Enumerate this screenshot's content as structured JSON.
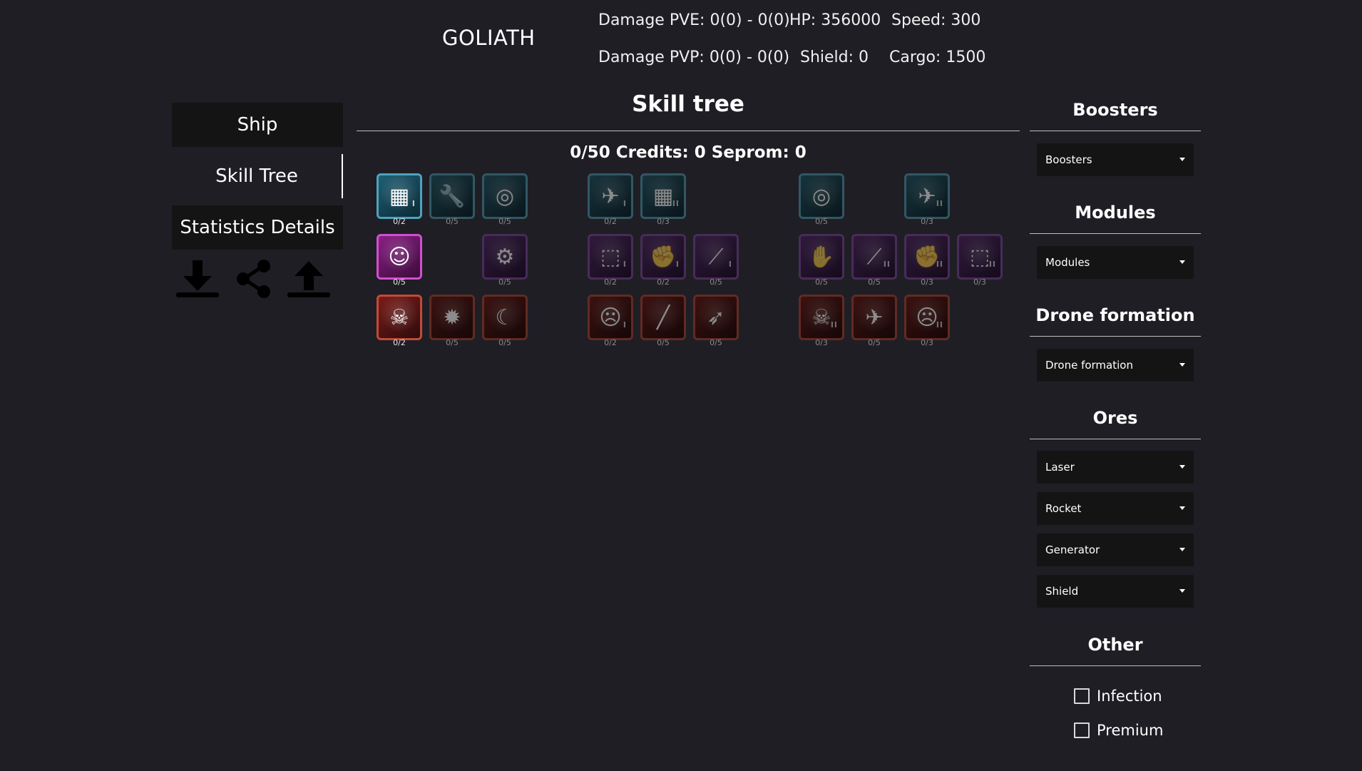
{
  "header": {
    "ship_name": "GOLIATH",
    "damage_pve": "Damage PVE: 0(0) - 0(0)",
    "hp": "HP: 356000",
    "speed": "Speed: 300",
    "damage_pvp": "Damage PVP: 0(0) - 0(0)",
    "shield": "Shield: 0",
    "cargo": "Cargo: 1500"
  },
  "menu": {
    "items": [
      {
        "label": "Ship",
        "active": false
      },
      {
        "label": "Skill Tree",
        "active": true
      },
      {
        "label": "Statistics Details",
        "active": false
      }
    ],
    "actions": [
      "download-icon",
      "share-icon",
      "upload-icon"
    ]
  },
  "skill_tree": {
    "title": "Skill tree",
    "summary": "0/50 Credits: 0 Seprom: 0",
    "skills": [
      {
        "level": "0/2",
        "color": "blue",
        "icon": "cargo-icon",
        "tier": "I",
        "bright": true
      },
      {
        "level": "0/5",
        "color": "blue",
        "icon": "wrench-icon",
        "tier": "",
        "bright": false
      },
      {
        "level": "0/5",
        "color": "blue",
        "icon": "ship-radar-icon",
        "tier": "",
        "bright": false
      },
      {
        "level": "0/5",
        "color": "magenta",
        "icon": "pilot-icon",
        "tier": "",
        "bright": true
      },
      {
        "level": "0/5",
        "color": "purple",
        "icon": "cannon-icon",
        "tier": "",
        "bright": false
      },
      {
        "level": "0/2",
        "color": "red",
        "icon": "skull-icon",
        "tier": "",
        "bright": true
      },
      {
        "level": "0/5",
        "color": "red",
        "icon": "explosion-icon",
        "tier": "",
        "bright": false
      },
      {
        "level": "0/5",
        "color": "red",
        "icon": "scythe-icon",
        "tier": "",
        "bright": false
      },
      {
        "level": "0/2",
        "color": "blue",
        "icon": "ship-icon",
        "tier": "I",
        "bright": false
      },
      {
        "level": "0/3",
        "color": "blue",
        "icon": "cargo-icon",
        "tier": "II",
        "bright": false
      },
      {
        "level": "0/2",
        "color": "purple",
        "icon": "cube-icon",
        "tier": "I",
        "bright": false
      },
      {
        "level": "0/2",
        "color": "purple",
        "icon": "fist-icon",
        "tier": "I",
        "bright": false
      },
      {
        "level": "0/5",
        "color": "purple",
        "icon": "laser-icon",
        "tier": "I",
        "bright": false
      },
      {
        "level": "0/2",
        "color": "red",
        "icon": "face-icon",
        "tier": "I",
        "bright": false
      },
      {
        "level": "0/5",
        "color": "red",
        "icon": "rifle-icon",
        "tier": "",
        "bright": false
      },
      {
        "level": "0/5",
        "color": "red",
        "icon": "rocket-icon",
        "tier": "",
        "bright": false
      },
      {
        "level": "0/5",
        "color": "blue",
        "icon": "ship-radar-icon",
        "tier": "",
        "bright": false
      },
      {
        "level": "0/3",
        "color": "blue",
        "icon": "ship-icon",
        "tier": "II",
        "bright": false
      },
      {
        "level": "0/5",
        "color": "purple",
        "icon": "hand-icon",
        "tier": "",
        "bright": false
      },
      {
        "level": "0/5",
        "color": "purple",
        "icon": "laser-icon",
        "tier": "II",
        "bright": false
      },
      {
        "level": "0/3",
        "color": "purple",
        "icon": "fist-icon",
        "tier": "II",
        "bright": false
      },
      {
        "level": "0/3",
        "color": "purple",
        "icon": "cube-icon",
        "tier": "II",
        "bright": false
      },
      {
        "level": "0/3",
        "color": "red",
        "icon": "skull-icon",
        "tier": "II",
        "bright": false
      },
      {
        "level": "0/5",
        "color": "red",
        "icon": "fighter-icon",
        "tier": "",
        "bright": false
      },
      {
        "level": "0/3",
        "color": "red",
        "icon": "face-icon",
        "tier": "II",
        "bright": false
      }
    ]
  },
  "sidebar": {
    "boosters_title": "Boosters",
    "boosters_select": "Boosters",
    "modules_title": "Modules",
    "modules_select": "Modules",
    "drone_title": "Drone formation",
    "drone_select": "Drone formation",
    "ores_title": "Ores",
    "ores": [
      "Laser",
      "Rocket",
      "Generator",
      "Shield"
    ],
    "other_title": "Other",
    "options": [
      {
        "label": "Infection",
        "checked": false
      },
      {
        "label": "Premium",
        "checked": false
      }
    ]
  }
}
